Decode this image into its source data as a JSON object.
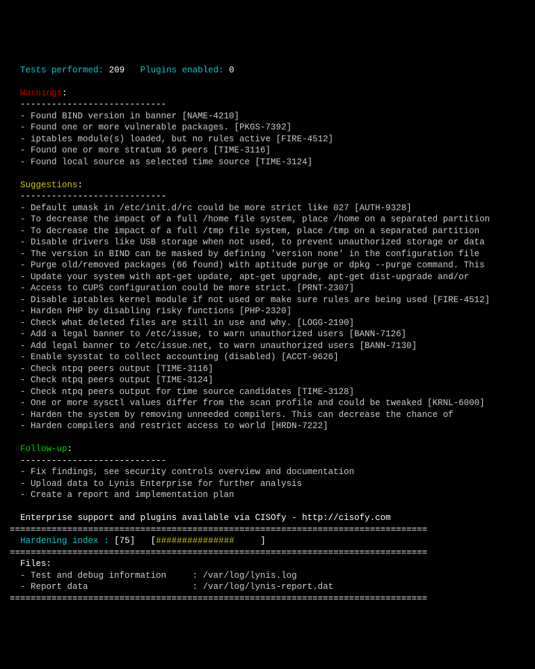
{
  "header": {
    "tests_label": "Tests performed",
    "tests_value": "209",
    "plugins_label": "Plugins enabled",
    "plugins_value": "0"
  },
  "warnings": {
    "title": "Warnings",
    "divider": "----------------------------",
    "items": [
      "Found BIND version in banner [NAME-4210]",
      "Found one or more vulnerable packages. [PKGS-7392]",
      "iptables module(s) loaded, but no rules active [FIRE-4512]",
      "Found one or more stratum 16 peers [TIME-3116]",
      "Found local source as selected time source [TIME-3124]"
    ]
  },
  "suggestions": {
    "title": "Suggestions",
    "divider": "----------------------------",
    "items": [
      "Default umask in /etc/init.d/rc could be more strict like 027 [AUTH-9328]",
      "To decrease the impact of a full /home file system, place /home on a separated partition",
      "To decrease the impact of a full /tmp file system, place /tmp on a separated partition",
      "Disable drivers like USB storage when not used, to prevent unauthorized storage or data",
      "The version in BIND can be masked by defining 'version none' in the configuration file",
      "Purge old/removed packages (66 found) with aptitude purge or dpkg --purge command. This",
      "Update your system with apt-get update, apt-get upgrade, apt-get dist-upgrade and/or",
      "Access to CUPS configuration could be more strict. [PRNT-2307]",
      "Disable iptables kernel module if not used or make sure rules are being used [FIRE-4512]",
      "Harden PHP by disabling risky functions [PHP-2320]",
      "Check what deleted files are still in use and why. [LOGG-2190]",
      "Add a legal banner to /etc/issue, to warn unauthorized users [BANN-7126]",
      "Add legal banner to /etc/issue.net, to warn unauthorized users [BANN-7130]",
      "Enable sysstat to collect accounting (disabled) [ACCT-9626]",
      "Check ntpq peers output [TIME-3116]",
      "Check ntpq peers output [TIME-3124]",
      "Check ntpq peers output for time source candidates [TIME-3128]",
      "One or more sysctl values differ from the scan profile and could be tweaked [KRNL-6000]",
      "Harden the system by removing unneeded compilers. This can decrease the chance of",
      "Harden compilers and restrict access to world [HRDN-7222]"
    ]
  },
  "followup": {
    "title": "Follow-up",
    "divider": "----------------------------",
    "items": [
      "Fix findings, see security controls overview and documentation",
      "Upload data to Lynis Enterprise for further analysis",
      "Create a report and implementation plan"
    ]
  },
  "support": {
    "text": "Enterprise support and plugins available via CISOfy - http://cisofy.com"
  },
  "eqline": "================================================================================",
  "hardening": {
    "label": "Hardening index",
    "value": "75",
    "bar_filled": "###############",
    "bar_empty": "     "
  },
  "files": {
    "title": "Files",
    "rows": [
      {
        "label": "Test and debug information",
        "path": "/var/log/lynis.log"
      },
      {
        "label": "Report data",
        "path": "/var/log/lynis-report.dat"
      }
    ]
  }
}
